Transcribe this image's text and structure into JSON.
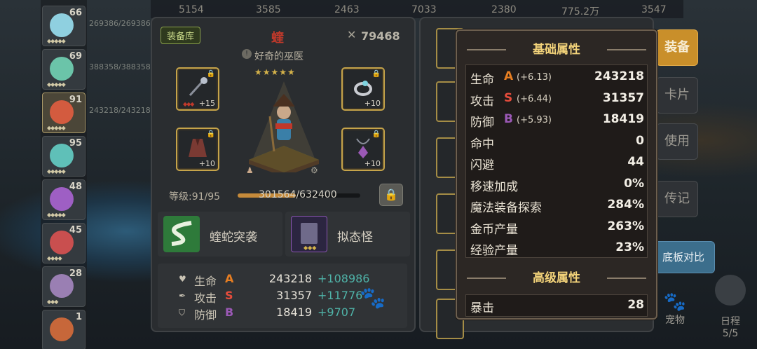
{
  "top_bar": {
    "values": [
      "5154",
      "3585",
      "2463",
      "7033",
      "2380",
      "775.2万",
      "3547"
    ]
  },
  "roster": [
    {
      "level": "66",
      "hp": "269386/269386",
      "stars": "◆◆◆◆◆",
      "color": "#8fd0e0"
    },
    {
      "level": "69",
      "hp": "388358/388358",
      "stars": "◆◆◆◆◆",
      "color": "#6bc4a9"
    },
    {
      "level": "91",
      "hp": "243218/243218",
      "stars": "◆◆◆◆◆",
      "color": "#d35b3f"
    },
    {
      "level": "95",
      "hp": "",
      "stars": "◆◆◆◆◆",
      "color": "#5fc0b8"
    },
    {
      "level": "48",
      "hp": "",
      "stars": "◆◆◆◆◆",
      "color": "#9e5fc4"
    },
    {
      "level": "45",
      "hp": "",
      "stars": "◆◆◆◆",
      "color": "#c94f4f"
    },
    {
      "level": "28",
      "hp": "",
      "stars": "◆◆◆",
      "color": "#9a7fb3"
    },
    {
      "level": "1",
      "hp": "",
      "stars": "",
      "color": "#c7673a"
    }
  ],
  "equip_panel": {
    "tag": "装备库",
    "hero_name": "蝰",
    "power": "79468",
    "title": "好奇的巫医",
    "stars": "★★★★★",
    "slots": [
      {
        "name": "staff",
        "plus": "+15"
      },
      {
        "name": "ring",
        "plus": "+10"
      },
      {
        "name": "robe",
        "plus": "+10"
      },
      {
        "name": "amulet",
        "plus": "+10"
      }
    ],
    "level_label": "等级:91/95",
    "exp_label": "301564/632400",
    "exp_fraction": 0.477,
    "skills": [
      "蝰蛇突袭",
      "拟态怪"
    ],
    "stats": [
      {
        "name": "生命",
        "grade": "A",
        "value": "243218",
        "delta": "+108986"
      },
      {
        "name": "攻击",
        "grade": "S",
        "value": "31357",
        "delta": "+11776"
      },
      {
        "name": "防御",
        "grade": "B",
        "value": "18419",
        "delta": "+9707"
      }
    ]
  },
  "side_buttons": {
    "equip": "装备",
    "card": "卡片",
    "use": "使用",
    "bio": "传记",
    "compare": "底板对比",
    "pet": "宠物",
    "schedule": "日程",
    "schedule_count": "5/5"
  },
  "popup": {
    "basic_title": "基础属性",
    "advanced_title": "高级属性",
    "basic": [
      {
        "name": "生命",
        "grade": "A",
        "bonus": "(+6.13)",
        "value": "243218"
      },
      {
        "name": "攻击",
        "grade": "S",
        "bonus": "(+6.44)",
        "value": "31357"
      },
      {
        "name": "防御",
        "grade": "B",
        "bonus": "(+5.93)",
        "value": "18419"
      },
      {
        "name": "命中",
        "grade": "",
        "bonus": "",
        "value": "0"
      },
      {
        "name": "闪避",
        "grade": "",
        "bonus": "",
        "value": "44"
      },
      {
        "name": "移速加成",
        "grade": "",
        "bonus": "",
        "value": "0%"
      },
      {
        "name": "魔法装备探索",
        "grade": "",
        "bonus": "",
        "value": "284%"
      },
      {
        "name": "金币产量",
        "grade": "",
        "bonus": "",
        "value": "263%"
      },
      {
        "name": "经验产量",
        "grade": "",
        "bonus": "",
        "value": "23%"
      }
    ],
    "advanced": [
      {
        "name": "暴击",
        "value": "28"
      }
    ]
  },
  "colors": {
    "grade_A": "#e67e22",
    "grade_S": "#e74c3c",
    "grade_B": "#9b59b6",
    "accent": "#f3d37a"
  }
}
